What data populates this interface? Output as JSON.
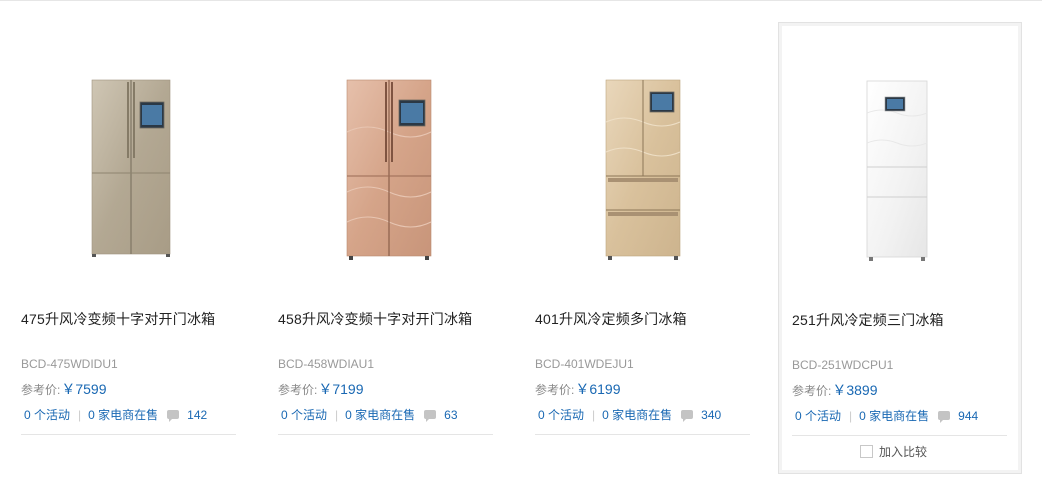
{
  "products": [
    {
      "title": "475升风冷变频十字对开门冰箱",
      "model": "BCD-475WDIDU1",
      "price_label": "参考价:",
      "price_value": "￥7599",
      "activities": "0 个活动",
      "dealers": "0 家电商在售",
      "comments": "142",
      "fridge_style": "cross-door",
      "color": "#b8ad98"
    },
    {
      "title": "458升风冷变频十字对开门冰箱",
      "model": "BCD-458WDIAU1",
      "price_label": "参考价:",
      "price_value": "￥7199",
      "activities": "0 个活动",
      "dealers": "0 家电商在售",
      "comments": "63",
      "fridge_style": "cross-door",
      "color": "#d9ab93"
    },
    {
      "title": "401升风冷定频多门冰箱",
      "model": "BCD-401WDEJU1",
      "price_label": "参考价:",
      "price_value": "￥6199",
      "activities": "0 个活动",
      "dealers": "0 家电商在售",
      "comments": "340",
      "fridge_style": "french-door",
      "color": "#dac4a3"
    },
    {
      "title": "251升风冷定频三门冰箱",
      "model": "BCD-251WDCPU1",
      "price_label": "参考价:",
      "price_value": "￥3899",
      "activities": "0 个活动",
      "dealers": "0 家电商在售",
      "comments": "944",
      "fridge_style": "three-door",
      "color": "#f4f4f4",
      "compare_label": "加入比较"
    }
  ],
  "icons": {
    "comment": "comment-bubble-icon",
    "checkbox": "compare-checkbox-icon"
  }
}
